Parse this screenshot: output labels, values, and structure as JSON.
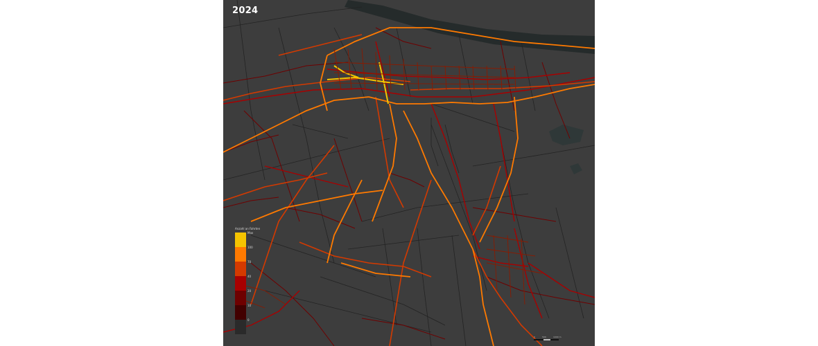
{
  "map": {
    "year_label": "2024",
    "legend": {
      "title": "Anzahl an Fahrten",
      "bins": [
        {
          "label": "Max",
          "color": "#f5c400"
        },
        {
          "label": "100",
          "color": "#ff7a00"
        },
        {
          "label": "70",
          "color": "#d43a00"
        },
        {
          "label": "40",
          "color": "#a80000"
        },
        {
          "label": "20",
          "color": "#6e0000"
        },
        {
          "label": "10",
          "color": "#420000"
        },
        {
          "label": "0",
          "color": "#2a2a2a"
        }
      ]
    },
    "scale": {
      "labels": [
        "0",
        "500",
        "1000 m"
      ]
    },
    "colors": {
      "background": "#3d3d3d",
      "river": "#252b2b",
      "water": "#2f3838",
      "street_base": "#232323",
      "low": "#6e0000",
      "mid": "#a80000",
      "high": "#d43a00",
      "top": "#ff7a00",
      "max": "#f5c400"
    }
  }
}
